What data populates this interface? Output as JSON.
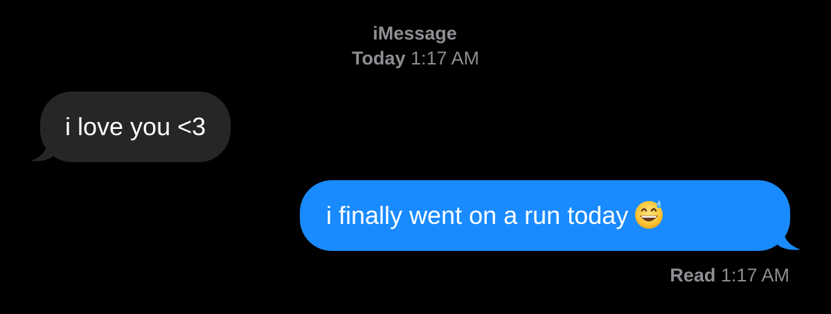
{
  "header": {
    "service": "iMessage",
    "day": "Today",
    "time": "1:17 AM"
  },
  "messages": [
    {
      "direction": "incoming",
      "text": "i love you <3"
    },
    {
      "direction": "outgoing",
      "text": "i finally went on a run today",
      "emoji": "grinning-face-with-sweat-icon"
    }
  ],
  "receipt": {
    "label": "Read",
    "time": "1:17 AM"
  },
  "colors": {
    "background": "#000000",
    "incoming_bubble": "#262628",
    "outgoing_bubble": "#1a8bff",
    "meta_text": "#8e8e93"
  }
}
